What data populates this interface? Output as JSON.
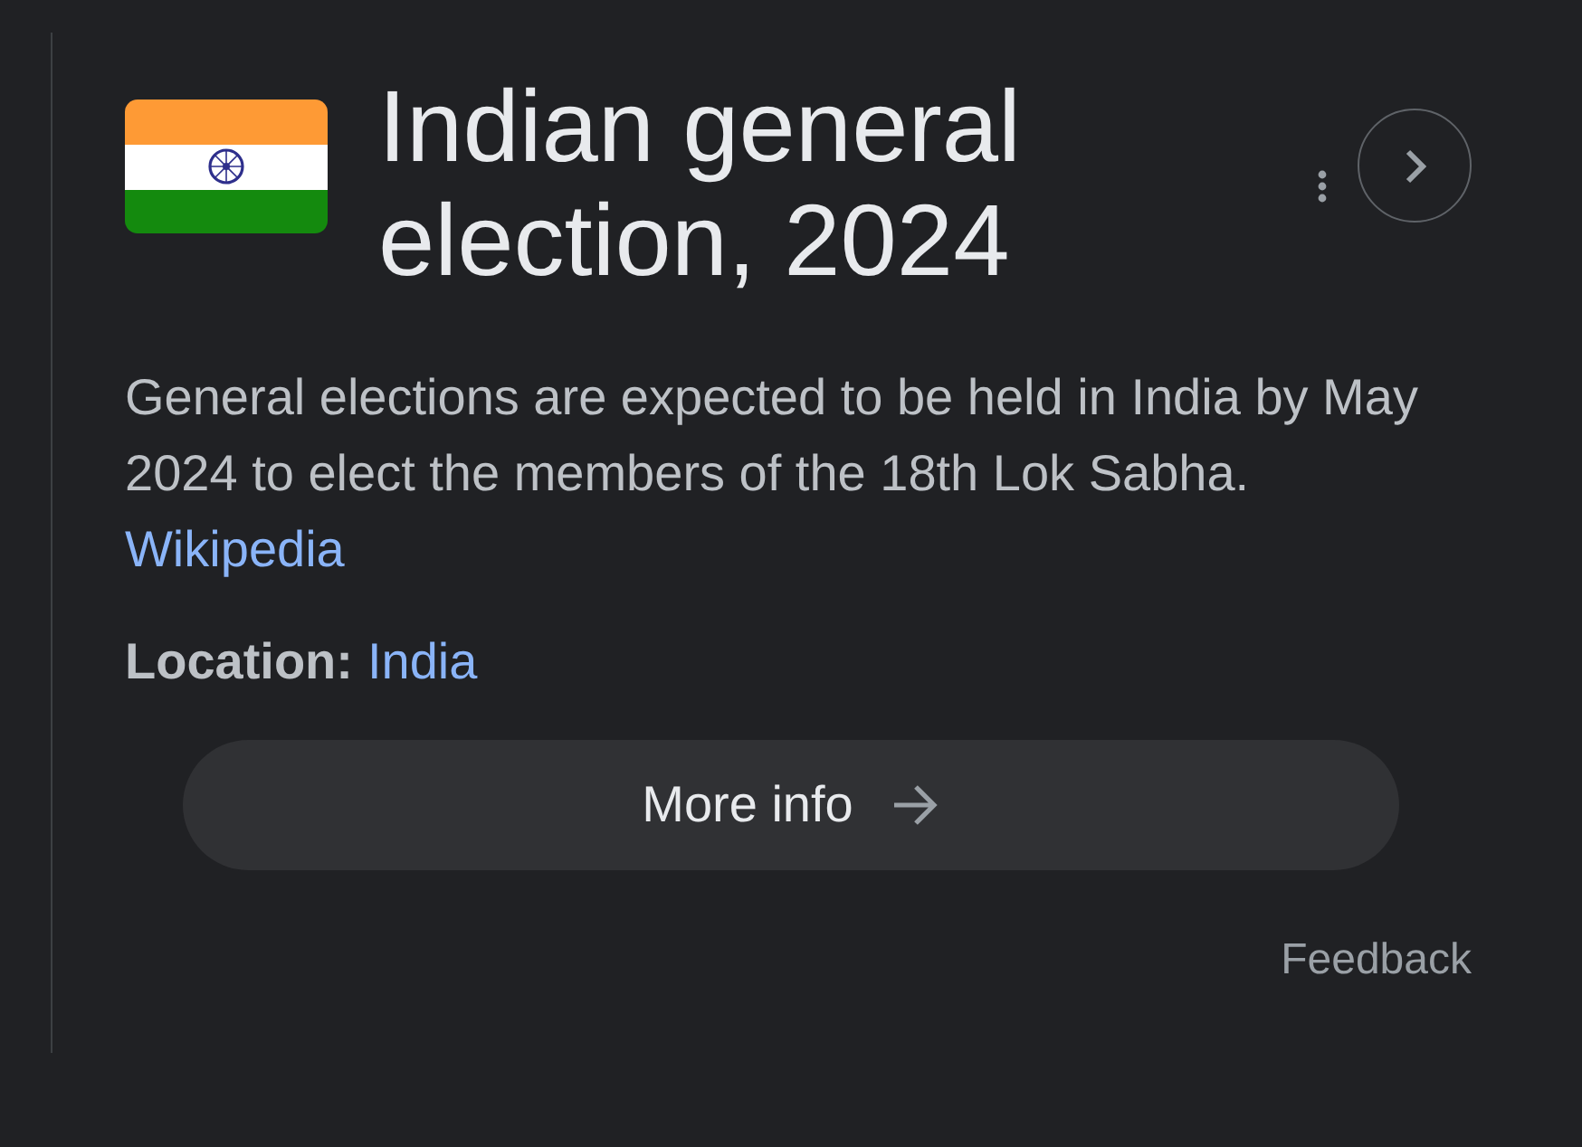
{
  "title": "Indian general election, 2024",
  "description": "General elections are expected to be held in India by May 2024 to elect the members of the 18th Lok Sabha.",
  "source_link": "Wikipedia",
  "facts": [
    {
      "label": "Location:",
      "value": "India"
    }
  ],
  "more_info_button": "More info",
  "feedback": "Feedback"
}
